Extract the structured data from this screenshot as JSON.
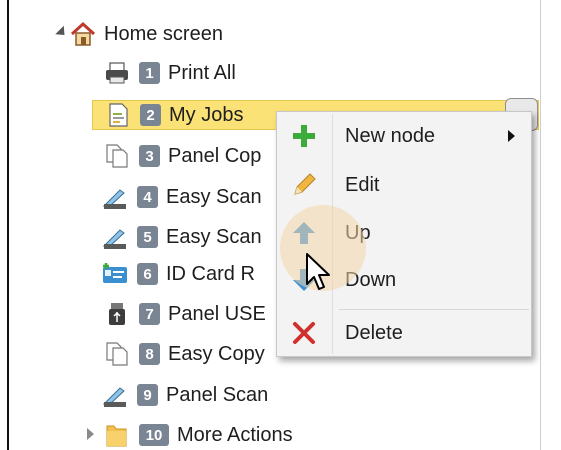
{
  "tree": {
    "root": {
      "label": "Home screen",
      "icon": "house-icon"
    },
    "items": [
      {
        "number": "1",
        "label": "Print All",
        "icon": "printer-icon"
      },
      {
        "number": "2",
        "label": "My Jobs",
        "icon": "document-icon",
        "selected": true
      },
      {
        "number": "3",
        "label": "Panel Cop",
        "icon": "copy-icon"
      },
      {
        "number": "4",
        "label": "Easy Scan",
        "icon": "scanner-icon"
      },
      {
        "number": "5",
        "label": "Easy Scan",
        "icon": "scanner-icon"
      },
      {
        "number": "6",
        "label": "ID Card R",
        "icon": "id-card-icon"
      },
      {
        "number": "7",
        "label": "Panel USE",
        "icon": "usb-icon"
      },
      {
        "number": "8",
        "label": "Easy Copy",
        "icon": "copy-icon"
      },
      {
        "number": "9",
        "label": "Panel Scan",
        "icon": "scanner-icon"
      },
      {
        "number": "10",
        "label": "More Actions",
        "icon": "folder-icon"
      }
    ]
  },
  "context_menu": {
    "items": [
      {
        "label": "New node",
        "icon": "plus-icon",
        "has_submenu": true
      },
      {
        "label": "Edit",
        "icon": "pencil-icon"
      },
      {
        "label": "Up",
        "icon": "arrow-up-icon"
      },
      {
        "label": "Down",
        "icon": "arrow-down-icon",
        "hovered": true
      },
      {
        "label": "Delete",
        "icon": "delete-x-icon"
      }
    ]
  },
  "colors": {
    "selection": "#fbe276",
    "badge": "#7a8593",
    "menu_bg": "#f3f3f3",
    "plus": "#3cab3c",
    "delete": "#d0312d",
    "arrow": "#3d8fd6"
  }
}
